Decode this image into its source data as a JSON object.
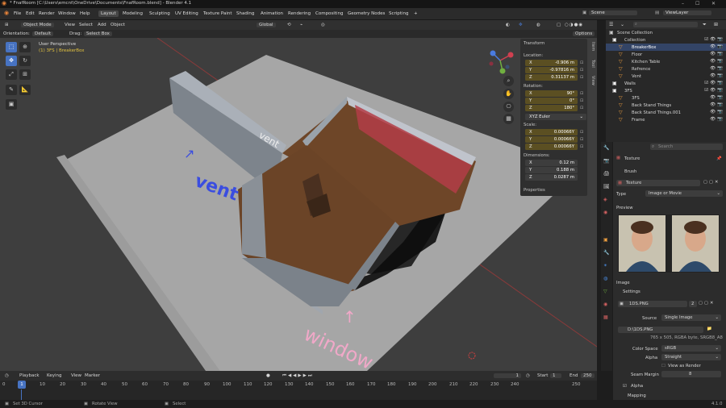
{
  "title_bar": {
    "title": "* FnafRoom [C:\\Users\\emcnt\\OneDrive\\Documents\\FnafRoom.blend] - Blender 4.1",
    "minimize": "–",
    "maximize": "☐",
    "close": "✕"
  },
  "menu": [
    "File",
    "Edit",
    "Render",
    "Window",
    "Help"
  ],
  "workspaces": [
    "Layout",
    "Modeling",
    "Sculpting",
    "UV Editing",
    "Texture Paint",
    "Shading",
    "Animation",
    "Rendering",
    "Compositing",
    "Geometry Nodes",
    "Scripting",
    "+"
  ],
  "scene": {
    "label": "Scene",
    "view_layer": "ViewLayer"
  },
  "viewport_header": {
    "mode": "Object Mode",
    "view": "View",
    "select": "Select",
    "add": "Add",
    "object": "Object",
    "transform": "Global",
    "options": "Options"
  },
  "tool_settings": {
    "orientation_label": "Orientation:",
    "orientation": "Default",
    "drag_label": "Drag:",
    "drag": "Select Box"
  },
  "viewport": {
    "view_name": "User Perspective",
    "object_info": "(1) 3FS | BreakerBox",
    "annotations": {
      "vent": "vent",
      "window": "window",
      "vent_wall": "vent"
    }
  },
  "npanel": {
    "transform_title": "Transform",
    "location_label": "Location:",
    "location": [
      {
        "axis": "X",
        "value": "-0.906 m"
      },
      {
        "axis": "Y",
        "value": "-0.97816 m"
      },
      {
        "axis": "Z",
        "value": "0.31137 m"
      }
    ],
    "rotation_label": "Rotation:",
    "rotation": [
      {
        "axis": "X",
        "value": "90°"
      },
      {
        "axis": "Y",
        "value": "0°"
      },
      {
        "axis": "Z",
        "value": "180°"
      }
    ],
    "rotation_mode": "XYZ Euler",
    "scale_label": "Scale:",
    "scale": [
      {
        "axis": "X",
        "value": "0.00066Y"
      },
      {
        "axis": "Y",
        "value": "0.00066Y"
      },
      {
        "axis": "Z",
        "value": "0.00066Y"
      }
    ],
    "dimensions_label": "Dimensions:",
    "dimensions": [
      {
        "axis": "X",
        "value": "0.12 m"
      },
      {
        "axis": "Y",
        "value": "0.188 m"
      },
      {
        "axis": "Z",
        "value": "0.0287 m"
      }
    ],
    "properties_title": "Properties",
    "side_tabs": [
      "Item",
      "Tool",
      "View"
    ]
  },
  "outliner": {
    "search_placeholder": "",
    "items": [
      {
        "label": "Scene Collection",
        "indent": 0,
        "type": "scene"
      },
      {
        "label": "Collection",
        "indent": 1,
        "type": "collection"
      },
      {
        "label": "BreakerBox",
        "indent": 2,
        "type": "object",
        "selected": true
      },
      {
        "label": "Floor",
        "indent": 2,
        "type": "object"
      },
      {
        "label": "Kitchen Table",
        "indent": 2,
        "type": "object"
      },
      {
        "label": "Refrence",
        "indent": 2,
        "type": "object"
      },
      {
        "label": "Vent",
        "indent": 2,
        "type": "object"
      },
      {
        "label": "Walls",
        "indent": 1,
        "type": "collection"
      },
      {
        "label": "3FS",
        "indent": 1,
        "type": "collection"
      },
      {
        "label": "3FS",
        "indent": 2,
        "type": "object"
      },
      {
        "label": "Back Stand Things",
        "indent": 2,
        "type": "object"
      },
      {
        "label": "Back Stand Things.001",
        "indent": 2,
        "type": "object"
      },
      {
        "label": "Frame",
        "indent": 2,
        "type": "object"
      }
    ]
  },
  "properties": {
    "search_placeholder": "Search",
    "context": "Texture",
    "brush": "Brush",
    "texture_name": "Texture",
    "type_label": "Type",
    "type_value": "Image or Movie",
    "preview_title": "Preview",
    "image_title": "Image",
    "settings_title": "Settings",
    "image_name": "1DS.PNG",
    "users": "2",
    "source_label": "Source",
    "source_value": "Single Image",
    "filepath": "D:\\1DS.PNG",
    "image_info": "765 x 505, RGBA byte, SRGB8_A8",
    "color_space_label": "Color Space",
    "color_space": "sRGB",
    "alpha_label": "Alpha",
    "alpha_value": "Straight",
    "view_as_render": "View as Render",
    "seam_margin_label": "Seam Margin",
    "seam_margin": "8",
    "alpha_section": "Alpha",
    "mapping_section": "Mapping"
  },
  "timeline": {
    "playback": "Playback",
    "keying": "Keying",
    "view": "View",
    "marker": "Marker",
    "current_frame": "1",
    "start_label": "Start",
    "start": "1",
    "end_label": "End",
    "end": "250",
    "ticks": [
      "0",
      "10",
      "20",
      "30",
      "40",
      "50",
      "60",
      "70",
      "80",
      "90",
      "100",
      "110",
      "120",
      "130",
      "140",
      "150",
      "160",
      "170",
      "180",
      "190",
      "200",
      "210",
      "220",
      "230",
      "240",
      "250"
    ],
    "playhead": "1"
  },
  "status": {
    "left": "Set 3D Cursor",
    "middle": "Rotate View",
    "right": "Select",
    "version": "4.1.0"
  },
  "colors": {
    "accent": "#4773c2",
    "selected_field": "#5b4f22",
    "floor": "#a5a5a5",
    "wood": "#6b4427",
    "wall": "#8b929a",
    "red_wall": "#c23a44",
    "vent_text": "#3a4de0",
    "window_text": "#f0a8c8"
  }
}
